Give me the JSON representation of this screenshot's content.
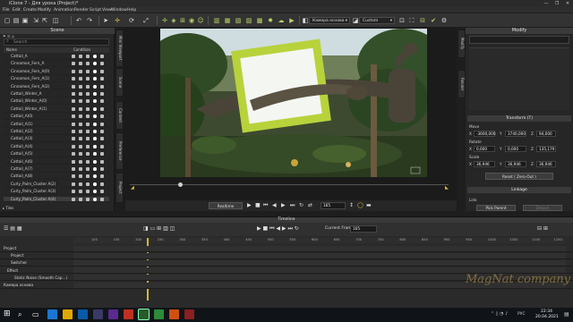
{
  "window": {
    "title": "iClone 7 - Для урока (Project)*",
    "controls": [
      "—",
      "❐",
      "✕"
    ]
  },
  "menu": [
    "File",
    "Edit",
    "Create",
    "Modify",
    "Animation",
    "Render",
    "Script",
    "View",
    "Window",
    "Help"
  ],
  "toolbar": {
    "camera_dropdown": "Камера основа",
    "view_dropdown": "Custom"
  },
  "scene": {
    "title": "Scene",
    "search_placeholder": "Search",
    "col_name": "Name",
    "col_condition": "Condition",
    "items": [
      "Cattail_A",
      "Cinnamon_Fern_A",
      "Cinnamon_Fern_A(0)",
      "Cinnamon_Fern_A(1)",
      "Cinnamon_Fern_A(2)",
      "Cattail_Winter_A",
      "Cattail_Winter_A(0)",
      "Cattail_Winter_A(1)",
      "Cattail_A(0)",
      "Cattail_A(1)",
      "Cattail_A(2)",
      "Cattail_A(3)",
      "Cattail_A(4)",
      "Cattail_A(5)",
      "Cattail_A(6)",
      "Cattail_A(7)",
      "Cattail_A(8)",
      "Curly_Palm_Cluster A(2)",
      "Curly_Palm_Cluster A(3)",
      "Curly_Palm_Cluster A(4)"
    ],
    "footer": "Tiles"
  },
  "side_tabs_left": [
    "Mini Viewport",
    "Scene",
    "Content",
    "Preference",
    "Project"
  ],
  "side_tabs_right": [
    "Modify",
    "Render"
  ],
  "viewport": {
    "controls": {
      "mode": "Realtime",
      "frame": "165"
    }
  },
  "modify": {
    "title": "Modify",
    "transform_title": "Transform  (T)",
    "move_label": "Move",
    "move": [
      "-3600,000",
      "3740,000",
      "94,000"
    ],
    "rotate_label": "Rotate",
    "rotate": [
      "0,000",
      "0,000",
      "135,179"
    ],
    "scale_label": "Scale",
    "scale": [
      "36,946",
      "36,946",
      "36,946"
    ],
    "reset_button": "Reset ( Zero-Out )",
    "linkage_title": "Linkage",
    "link_label": "Link",
    "pick_parent": "Pick Parent",
    "detach": "Detach"
  },
  "timeline": {
    "title": "Timeline",
    "current_frame_label": "Current Frame",
    "current_frame": "165",
    "ticks": [
      "100",
      "150",
      "200",
      "250",
      "300",
      "350",
      "400",
      "450",
      "500",
      "550",
      "600",
      "650",
      "700",
      "750",
      "800",
      "850",
      "900",
      "950",
      "1000",
      "1050",
      "1100",
      "1150"
    ],
    "rows": [
      "Project",
      "Project",
      "Switcher",
      "Effect",
      "Static Noise (Smooth Cap...)",
      "Камера основа"
    ]
  },
  "taskbar": {
    "time": "22:34",
    "date": "20.04.2021",
    "lang": "РУС"
  },
  "watermark": "MagNat company"
}
